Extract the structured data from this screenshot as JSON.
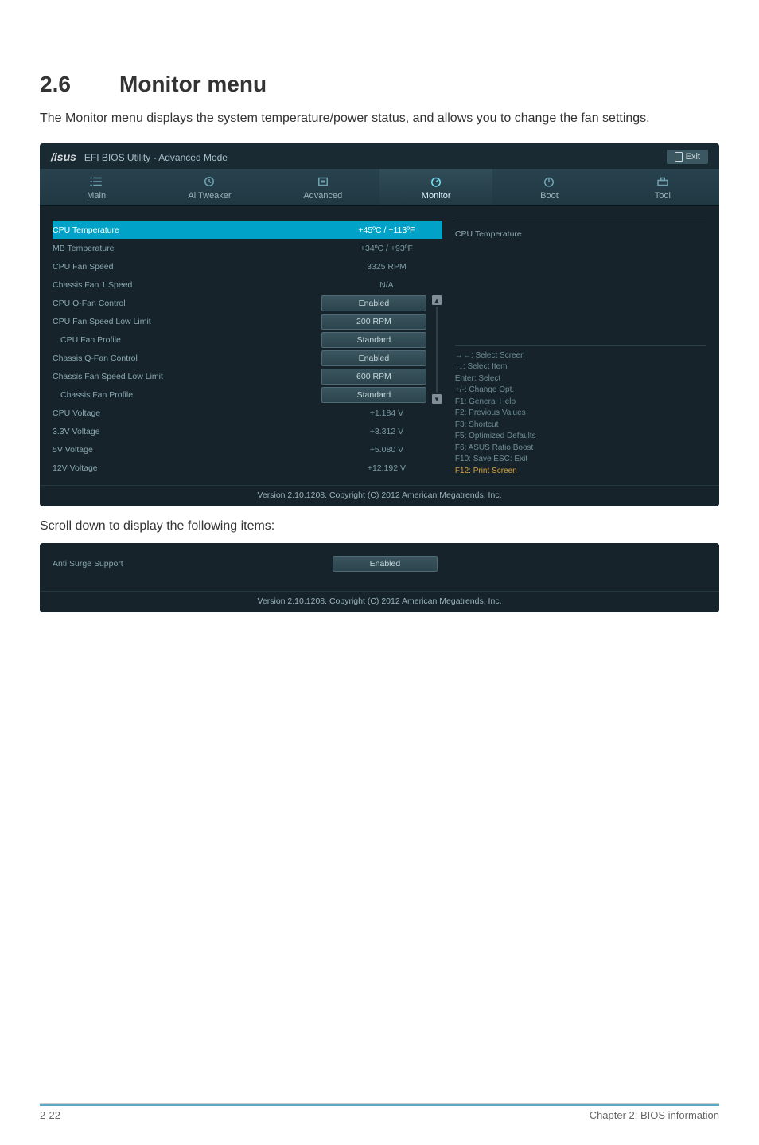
{
  "heading": {
    "num": "2.6",
    "title": "Monitor menu"
  },
  "intro": "The Monitor menu displays the system temperature/power status, and allows you to change the fan settings.",
  "titlebar": {
    "logo_left": "/isus",
    "title": "EFI BIOS Utility - Advanced Mode",
    "exit": "Exit"
  },
  "tabs": [
    {
      "key": "main",
      "label": "Main"
    },
    {
      "key": "ai",
      "label": "Ai  Tweaker"
    },
    {
      "key": "adv",
      "label": "Advanced"
    },
    {
      "key": "mon",
      "label": "Monitor"
    },
    {
      "key": "boot",
      "label": "Boot"
    },
    {
      "key": "tool",
      "label": "Tool"
    }
  ],
  "rows": [
    {
      "label": "CPU Temperature",
      "value": "+45ºC / +113ºF",
      "highlight": true
    },
    {
      "label": "MB Temperature",
      "value": "+34ºC / +93ºF"
    },
    {
      "label": "CPU Fan Speed",
      "value": "3325 RPM"
    },
    {
      "label": "Chassis Fan 1 Speed",
      "value": "N/A"
    }
  ],
  "dd_rows": [
    {
      "label": "CPU Q-Fan Control",
      "value": "Enabled"
    },
    {
      "label": "CPU Fan Speed Low Limit",
      "value": "200 RPM"
    },
    {
      "label": "CPU Fan Profile",
      "value": "Standard",
      "indent": true
    },
    {
      "label": "Chassis Q-Fan Control",
      "value": "Enabled"
    },
    {
      "label": "Chassis Fan Speed Low Limit",
      "value": "600 RPM"
    },
    {
      "label": "Chassis Fan Profile",
      "value": "Standard",
      "indent": true
    }
  ],
  "volt_rows": [
    {
      "label": "CPU Voltage",
      "value": "+1.184 V"
    },
    {
      "label": "3.3V Voltage",
      "value": "+3.312 V"
    },
    {
      "label": "5V Voltage",
      "value": "+5.080 V"
    },
    {
      "label": "12V Voltage",
      "value": "+12.192 V"
    }
  ],
  "info_title": "CPU Temperature",
  "help": {
    "l1": "→←:  Select Screen",
    "l2": "↑↓:  Select Item",
    "l3": "Enter:  Select",
    "l4": "+/-:  Change Opt.",
    "l5": "F1:  General Help",
    "l6": "F2:  Previous Values",
    "l7": "F3:  Shortcut",
    "l8": "F5:  Optimized Defaults",
    "l9": "F6:  ASUS Ratio Boost",
    "l10": "F10:  Save    ESC:  Exit",
    "l11": "F12:  Print Screen"
  },
  "version": "Version  2.10.1208.   Copyright  (C)  2012  American  Megatrends,  Inc.",
  "caption": "Scroll down to display the following items:",
  "extra_row": {
    "label": "Anti Surge Support",
    "value": "Enabled"
  },
  "footer": {
    "left": "2-22",
    "right": "Chapter 2: BIOS information"
  }
}
